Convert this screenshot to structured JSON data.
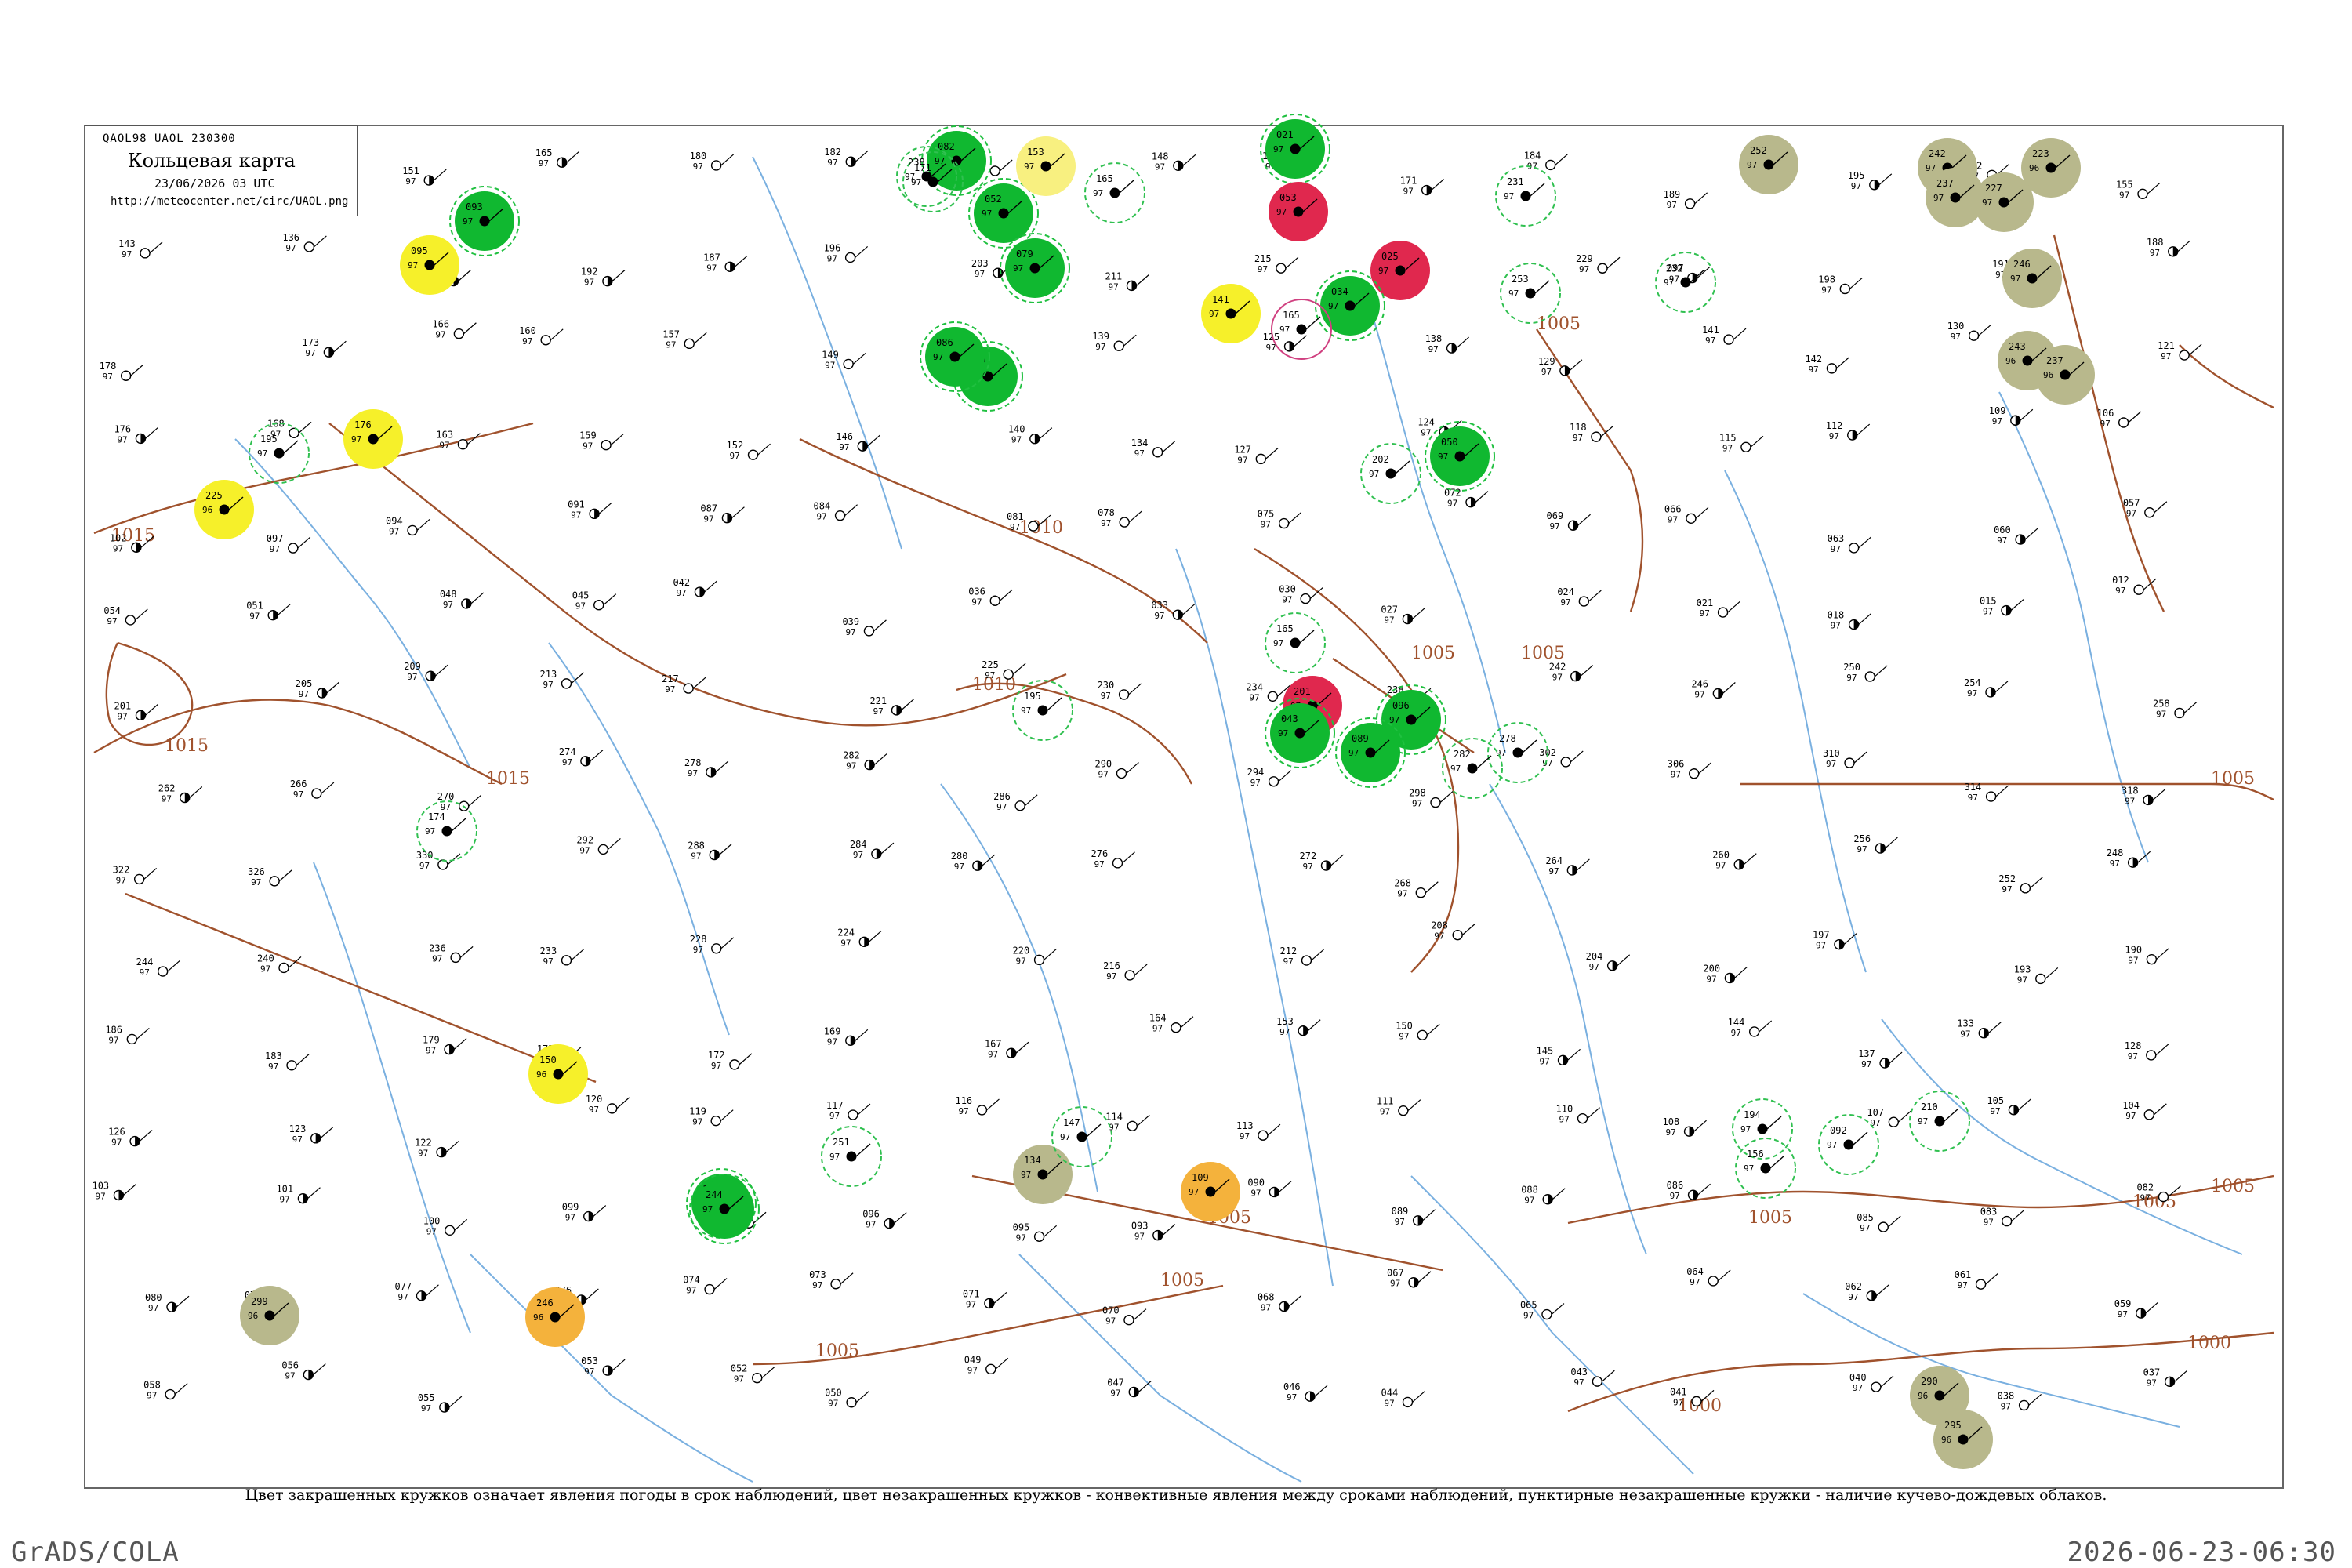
{
  "legend": {
    "codes": "QAOL98  UAOL  230300",
    "title": "Кольцевая карта",
    "date": "23/06/2026 03 UTC",
    "url": "http://meteocenter.net/circ/UAOL.png"
  },
  "caption": "Цвет закрашенных кружков означает явления погоды в срок наблюдений, цвет незакрашенных кружков - конвективные явления между сроками наблюдений, пунктирные незакрашенные кружки - наличие кучево-дождевых облаков.",
  "footer": {
    "left": "GrADS/COLA",
    "right": "2026-06-23-06:30"
  },
  "colors": {
    "isobar": "#a0522d",
    "river": "#7ab0e0",
    "thunder_green": "#10b830",
    "heavy_red": "#e0284e",
    "haze_yellow": "#f6f02a",
    "dust_orange": "#f4b23c",
    "fog_olive": "#b8b88c",
    "light_yellow": "#f8f080"
  },
  "isobars": {
    "labels": [
      "1015",
      "1015",
      "1015",
      "1010",
      "1010",
      "1005",
      "1005",
      "1005",
      "1005",
      "1005",
      "1005",
      "1005",
      "1005",
      "1000",
      "1000",
      "1005",
      "1005"
    ]
  },
  "stations": [
    {
      "id": "s1",
      "kind": "green",
      "val": "093",
      "p": "97"
    },
    {
      "id": "s2",
      "kind": "green",
      "val": "082",
      "p": "97"
    },
    {
      "id": "s3",
      "kind": "green",
      "val": "052",
      "p": "97"
    },
    {
      "id": "s4",
      "kind": "green",
      "val": "079",
      "p": "97"
    },
    {
      "id": "s5",
      "kind": "green",
      "val": "082",
      "p": "97"
    },
    {
      "id": "s6",
      "kind": "green",
      "val": "086",
      "p": "97"
    },
    {
      "id": "s7",
      "kind": "green",
      "val": "021",
      "p": "97"
    },
    {
      "id": "s8",
      "kind": "red",
      "val": "053",
      "p": "97"
    },
    {
      "id": "s9",
      "kind": "red",
      "val": "025",
      "p": "97"
    },
    {
      "id": "s10",
      "kind": "green",
      "val": "034",
      "p": "97"
    },
    {
      "id": "s11",
      "kind": "green",
      "val": "050",
      "p": "97"
    },
    {
      "id": "s12",
      "kind": "red",
      "val": "201",
      "p": "97"
    },
    {
      "id": "s13",
      "kind": "green",
      "val": "043",
      "p": "97"
    },
    {
      "id": "s14",
      "kind": "green",
      "val": "096",
      "p": "97"
    },
    {
      "id": "s15",
      "kind": "green",
      "val": "089",
      "p": "97"
    },
    {
      "id": "s16",
      "kind": "green",
      "val": "167",
      "p": "97"
    },
    {
      "id": "s17",
      "kind": "green",
      "val": "244",
      "p": "97"
    },
    {
      "id": "s18",
      "kind": "yellow",
      "val": "095",
      "p": "97"
    },
    {
      "id": "s19",
      "kind": "yellow",
      "val": "176",
      "p": "97"
    },
    {
      "id": "s20",
      "kind": "yellow",
      "val": "225",
      "p": "96"
    },
    {
      "id": "s21",
      "kind": "yellow",
      "val": "141",
      "p": "97"
    },
    {
      "id": "s22",
      "kind": "yellow",
      "val": "150",
      "p": "96"
    },
    {
      "id": "s23",
      "kind": "lightyellow",
      "val": "153",
      "p": "97"
    },
    {
      "id": "s24",
      "kind": "orange",
      "val": "109",
      "p": "97"
    },
    {
      "id": "s25",
      "kind": "orange",
      "val": "246",
      "p": "96"
    },
    {
      "id": "s26",
      "kind": "olive",
      "val": "252",
      "p": "97"
    },
    {
      "id": "s27",
      "kind": "olive",
      "val": "242",
      "p": "97"
    },
    {
      "id": "s28",
      "kind": "olive",
      "val": "237",
      "p": "97"
    },
    {
      "id": "s29",
      "kind": "olive",
      "val": "223",
      "p": "96"
    },
    {
      "id": "s30",
      "kind": "olive",
      "val": "227",
      "p": "97"
    },
    {
      "id": "s31",
      "kind": "olive",
      "val": "246",
      "p": "97"
    },
    {
      "id": "s32",
      "kind": "olive",
      "val": "243",
      "p": "96"
    },
    {
      "id": "s33",
      "kind": "olive",
      "val": "237",
      "p": "96"
    },
    {
      "id": "s34",
      "kind": "olive",
      "val": "134",
      "p": "97"
    },
    {
      "id": "s35",
      "kind": "olive",
      "val": "299",
      "p": "96"
    },
    {
      "id": "s36",
      "kind": "olive",
      "val": "290",
      "p": "96"
    },
    {
      "id": "s37",
      "kind": "olive",
      "val": "295",
      "p": "96"
    },
    {
      "id": "s38",
      "kind": "dashed",
      "val": "195",
      "p": "97"
    },
    {
      "id": "s39",
      "kind": "dashed",
      "val": "171",
      "p": "97"
    },
    {
      "id": "s40",
      "kind": "dashed",
      "val": "165",
      "p": "97"
    },
    {
      "id": "s41",
      "kind": "dashed",
      "val": "231",
      "p": "97"
    },
    {
      "id": "s42",
      "kind": "dashed",
      "val": "253",
      "p": "97"
    },
    {
      "id": "s43",
      "kind": "dashed",
      "val": "202",
      "p": "97"
    },
    {
      "id": "s44",
      "kind": "dashed",
      "val": "174",
      "p": "97"
    },
    {
      "id": "s45",
      "kind": "dashed",
      "val": "194",
      "p": "97"
    },
    {
      "id": "s46",
      "kind": "dashed",
      "val": "156",
      "p": "97"
    },
    {
      "id": "s47",
      "kind": "dashed",
      "val": "251",
      "p": "97"
    },
    {
      "id": "s48",
      "kind": "dashed",
      "val": "147",
      "p": "97"
    },
    {
      "id": "s49",
      "kind": "dashed",
      "val": "278",
      "p": "97"
    },
    {
      "id": "s50",
      "kind": "dashed",
      "val": "282",
      "p": "97"
    },
    {
      "id": "s51",
      "kind": "dashed",
      "val": "165",
      "p": "97"
    },
    {
      "id": "s52",
      "kind": "dashed",
      "val": "195",
      "p": "97"
    },
    {
      "id": "s53",
      "kind": "dashed",
      "val": "092",
      "p": "97"
    },
    {
      "id": "s54",
      "kind": "dashed",
      "val": "210",
      "p": "97"
    },
    {
      "id": "s55",
      "kind": "dashed",
      "val": "097",
      "p": "97"
    },
    {
      "id": "s56",
      "kind": "dashed",
      "val": "238",
      "p": "97"
    },
    {
      "id": "s57",
      "kind": "pinkring",
      "val": "165",
      "p": "97"
    }
  ],
  "plain_stations": [
    "177",
    "161",
    "151",
    "165",
    "180",
    "182",
    "154",
    "148",
    "158",
    "171",
    "184",
    "189",
    "195",
    "162",
    "155",
    "143",
    "136",
    "131",
    "192",
    "187",
    "196",
    "203",
    "211",
    "215",
    "223",
    "229",
    "232",
    "198",
    "191",
    "188",
    "178",
    "173",
    "166",
    "160",
    "157",
    "149",
    "147",
    "139",
    "125",
    "138",
    "129",
    "141",
    "142",
    "130",
    "121",
    "176",
    "168",
    "163",
    "159",
    "152",
    "146",
    "140",
    "134",
    "127",
    "124",
    "118",
    "115",
    "112",
    "109",
    "106",
    "102",
    "097",
    "094",
    "091",
    "087",
    "084",
    "081",
    "078",
    "075",
    "072",
    "069",
    "066",
    "063",
    "060",
    "057",
    "054",
    "051",
    "048",
    "045",
    "042",
    "039",
    "036",
    "033",
    "030",
    "027",
    "024",
    "021",
    "018",
    "015",
    "012",
    "201",
    "205",
    "209",
    "213",
    "217",
    "221",
    "225",
    "230",
    "234",
    "238",
    "242",
    "246",
    "250",
    "254",
    "258",
    "262",
    "266",
    "270",
    "274",
    "278",
    "282",
    "286",
    "290",
    "294",
    "298",
    "302",
    "306",
    "310",
    "314",
    "318",
    "322",
    "326",
    "330",
    "292",
    "288",
    "284",
    "280",
    "276",
    "272",
    "268",
    "264",
    "260",
    "256",
    "252",
    "248",
    "244",
    "240",
    "236",
    "233",
    "228",
    "224",
    "220",
    "216",
    "212",
    "208",
    "204",
    "200",
    "197",
    "193",
    "190",
    "186",
    "183",
    "179",
    "175",
    "172",
    "169",
    "167",
    "164",
    "153",
    "150",
    "145",
    "144",
    "137",
    "133",
    "128",
    "126",
    "123",
    "122",
    "120",
    "119",
    "117",
    "116",
    "114",
    "113",
    "111",
    "110",
    "108",
    "107",
    "105",
    "104",
    "103",
    "101",
    "100",
    "099",
    "098",
    "096",
    "095",
    "093",
    "090",
    "089",
    "088",
    "086",
    "085",
    "083",
    "082",
    "080",
    "079",
    "077",
    "076",
    "074",
    "073",
    "071",
    "070",
    "068",
    "067",
    "065",
    "064",
    "062",
    "061",
    "059",
    "058",
    "056",
    "055",
    "053",
    "052",
    "050",
    "049",
    "047",
    "046",
    "044",
    "043",
    "041",
    "040",
    "038",
    "037"
  ]
}
